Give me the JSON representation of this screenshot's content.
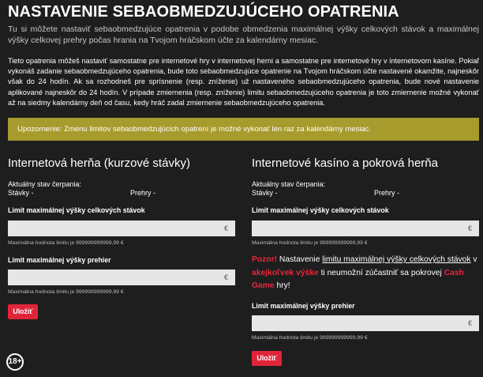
{
  "page": {
    "title": "NASTAVENIE SEBAOBMEDZUJÚCEHO OPATRENIA",
    "intro": "Tu si môžete nastaviť sebaobmedzujúce opatrenia v podobe obmedzenia maximálnej výšky celkových stávok a maximálnej výšky celkovej prehry počas hrania na Tvojom hráčskom účte za kalendárny mesiac.",
    "description": "Tieto opatrenia môžeš nastaviť samostatne pre internetové hry v internetovej herni a samostatne pre internetové hry v internetovom kasíne. Pokiaľ vykonáš zadanie sebaobmedzujúceho opatrenia, bude toto sebaobmedzujúce opatrenie na Tvojom hráčskom účte nastavené okamžite, najneskôr však do 24 hodín. Ak sa rozhodneš pre sprísnenie (resp. zníženie) už nastaveného sebaobmedzujúceho opatrenia, bude nové nastavenie aplikované najneskôr do 24 hodín. V prípade zmiernenia (resp. zníženie) limitu sebaobmedzujúceho opatrenia je toto zmiernenie možné vykonať až na siedmy kalendárny deň od času, kedy hráč zadal zmiernenie sebaobmedzujúceho opatrenia.",
    "notice": "Upozornenie: Zmenu limitov sebaobmedzujúcich opatrení je možné vykonať len raz za kalendárny mesiac.",
    "age_badge": "18+"
  },
  "left": {
    "title": "Internetová herňa (kurzové stávky)",
    "state_label": "Aktuálny stav čerpania:",
    "bets_label": "Stávky -",
    "losses_label": "Prehry -",
    "stakes_limit_label": "Limit maximálnej výšky celkových stávok",
    "stakes_value": "",
    "stakes_currency": "€",
    "stakes_hint": "Maximálna hodnota limitu je 999999999999,99 €",
    "loss_limit_label": "Limit maximálnej výšky prehier",
    "loss_value": "",
    "loss_currency": "€",
    "loss_hint": "Maximálna hodnota limitu je 999999999999,99 €",
    "save_label": "Uložiť"
  },
  "right": {
    "title": "Internetové kasíno a pokrová herňa",
    "state_label": "Aktuálny stav čerpania:",
    "bets_label": "Stávky -",
    "losses_label": "Prehry -",
    "stakes_limit_label": "Limit maximálnej výšky celkových stávok",
    "stakes_value": "",
    "stakes_currency": "€",
    "stakes_hint": "Maximálna hodnota limitu je 999999999999,99 €",
    "warning": {
      "pozor": "Pozor!",
      "part1": " Nastavenie ",
      "link": "limitu maximálnej výšky celkových stávok",
      "part2": " v ",
      "any_amount": "akejkoľvek výške",
      "part3": " ti neumožní zúčastniť sa pokrovej ",
      "cash_game": "Cash Game",
      "part4": " hry!"
    },
    "loss_limit_label": "Limit maximálnej výšky prehier",
    "loss_value": "",
    "loss_currency": "€",
    "loss_hint": "Maximálna hodnota limitu je 999999999999,99 €",
    "save_label": "Uložiť"
  },
  "colors": {
    "background": "#1e1e1e",
    "notice_bg": "#a89b2d",
    "accent_red": "#e0253a",
    "input_bg": "#e6e6e6"
  }
}
